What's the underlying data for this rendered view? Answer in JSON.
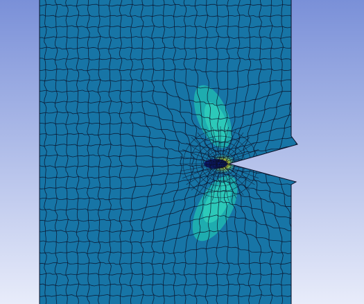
{
  "viewport": {
    "background_top": "#7a90d8",
    "background_bottom": "#e8ecfa"
  },
  "specimen": {
    "fill": "#1775a6",
    "mesh_line": "#0b0f26",
    "crack_hole_fill": "#0b1a6a"
  },
  "stress_field": {
    "low_color": "#1fb3b0",
    "mid_color": "#2fd1bc",
    "high_color": "#cfe83a",
    "peak_color": "#f2a11a"
  }
}
